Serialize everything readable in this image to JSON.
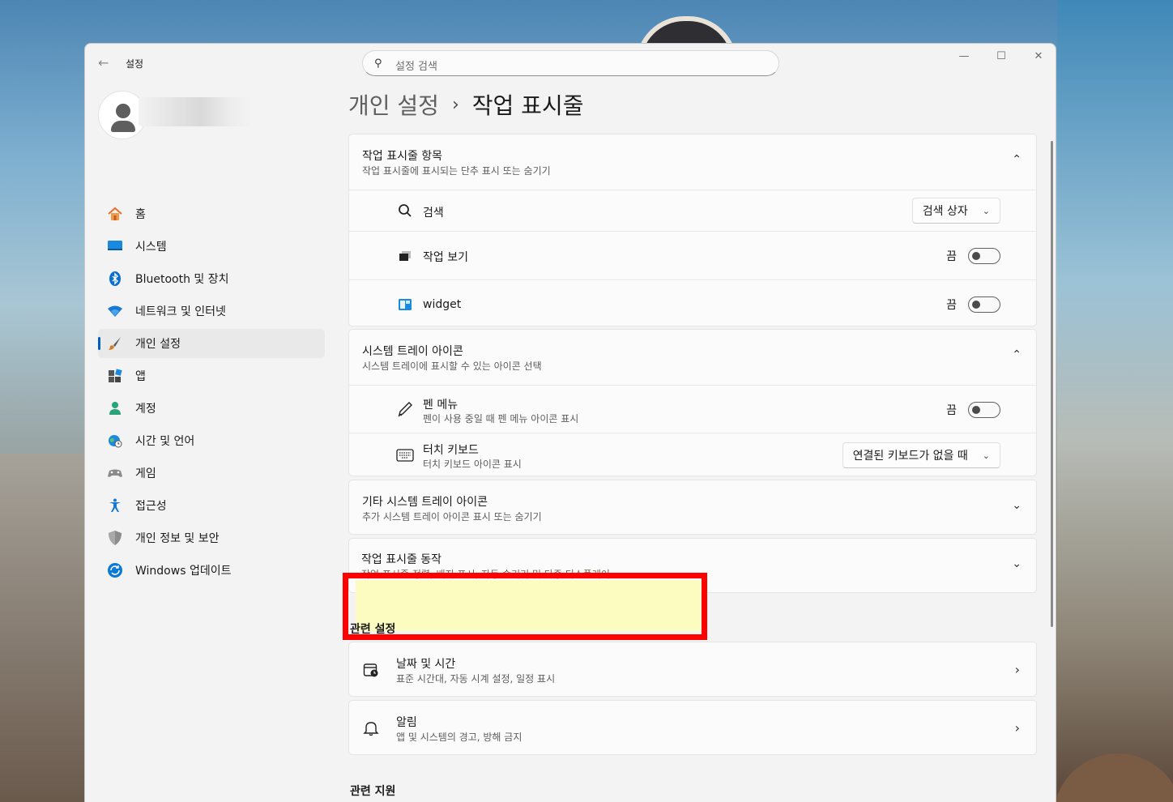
{
  "window": {
    "title": "설정"
  },
  "search": {
    "placeholder": "설정 검색"
  },
  "window_controls": {
    "minimize": "—",
    "maximize": "☐",
    "close": "✕"
  },
  "breadcrumb": {
    "parent": "개인 설정",
    "separator": "›",
    "current": "작업 표시줄"
  },
  "sidebar": {
    "items": [
      {
        "label": "홈",
        "icon": "home-icon",
        "color": "#e8702a"
      },
      {
        "label": "시스템",
        "icon": "monitor-icon",
        "color": "#0a7ad4"
      },
      {
        "label": "Bluetooth 및 장치",
        "icon": "bluetooth-icon",
        "color": "#0a7ad4"
      },
      {
        "label": "네트워크 및 인터넷",
        "icon": "wifi-icon",
        "color": "#1779d1"
      },
      {
        "label": "개인 설정",
        "icon": "brush-icon",
        "color": "#d47b2a",
        "active": true
      },
      {
        "label": "앱",
        "icon": "apps-icon",
        "color": "#3a3a3a"
      },
      {
        "label": "계정",
        "icon": "person-icon",
        "color": "#2aa37a"
      },
      {
        "label": "시간 및 언어",
        "icon": "globe-clock-icon",
        "color": "#0a7ad4"
      },
      {
        "label": "게임",
        "icon": "gamepad-icon",
        "color": "#707070"
      },
      {
        "label": "접근성",
        "icon": "accessibility-icon",
        "color": "#1779d1"
      },
      {
        "label": "개인 정보 및 보안",
        "icon": "shield-icon",
        "color": "#6d6d6d"
      },
      {
        "label": "Windows 업데이트",
        "icon": "update-icon",
        "color": "#0a7ad4"
      }
    ]
  },
  "taskbar_items": {
    "title": "작업 표시줄 항목",
    "subtitle": "작업 표시줄에 표시되는 단추 표시 또는 숨기기",
    "chevron": "⌃",
    "rows": {
      "search": {
        "label": "검색",
        "value": "검색 상자",
        "chevron": "⌄"
      },
      "task_view": {
        "label": "작업 보기",
        "state": "끔"
      },
      "widget": {
        "label": "widget",
        "state": "끔"
      }
    }
  },
  "tray_icons": {
    "title": "시스템 트레이 아이콘",
    "subtitle": "시스템 트레이에 표시할 수 있는 아이콘 선택",
    "chevron": "⌃",
    "rows": {
      "pen_menu": {
        "label": "펜 메뉴",
        "sub": "펜이 사용 중일 때 펜 메뉴 아이콘 표시",
        "state": "끔"
      },
      "touch_keyboard": {
        "label": "터치 키보드",
        "sub": "터치 키보드 아이콘 표시",
        "value": "연결된 키보드가 없을 때",
        "chevron": "⌄"
      }
    }
  },
  "other_tray": {
    "title": "기타 시스템 트레이 아이콘",
    "subtitle": "추가 시스템 트레이 아이콘 표시 또는 숨기기",
    "chevron": "⌄"
  },
  "taskbar_behaviors": {
    "title": "작업 표시줄 동작",
    "subtitle": "작업 표시줄 정렬, 배지 표시, 자동 숨기기 및 다중 디스플레이",
    "chevron": "⌄"
  },
  "related_settings": {
    "title": "관련 설정",
    "items": [
      {
        "title": "날짜 및 시간",
        "subtitle": "표준 시간대, 자동 시계 설정, 일정 표시",
        "chevron": "›"
      },
      {
        "title": "알림",
        "subtitle": "앱 및 시스템의 경고, 방해 금지",
        "chevron": "›"
      }
    ]
  },
  "related_support": {
    "title": "관련 지원"
  },
  "colors": {
    "accent": "#005fb8",
    "highlight_border": "#ff0000",
    "highlight_fill": "#fdfcc0"
  }
}
